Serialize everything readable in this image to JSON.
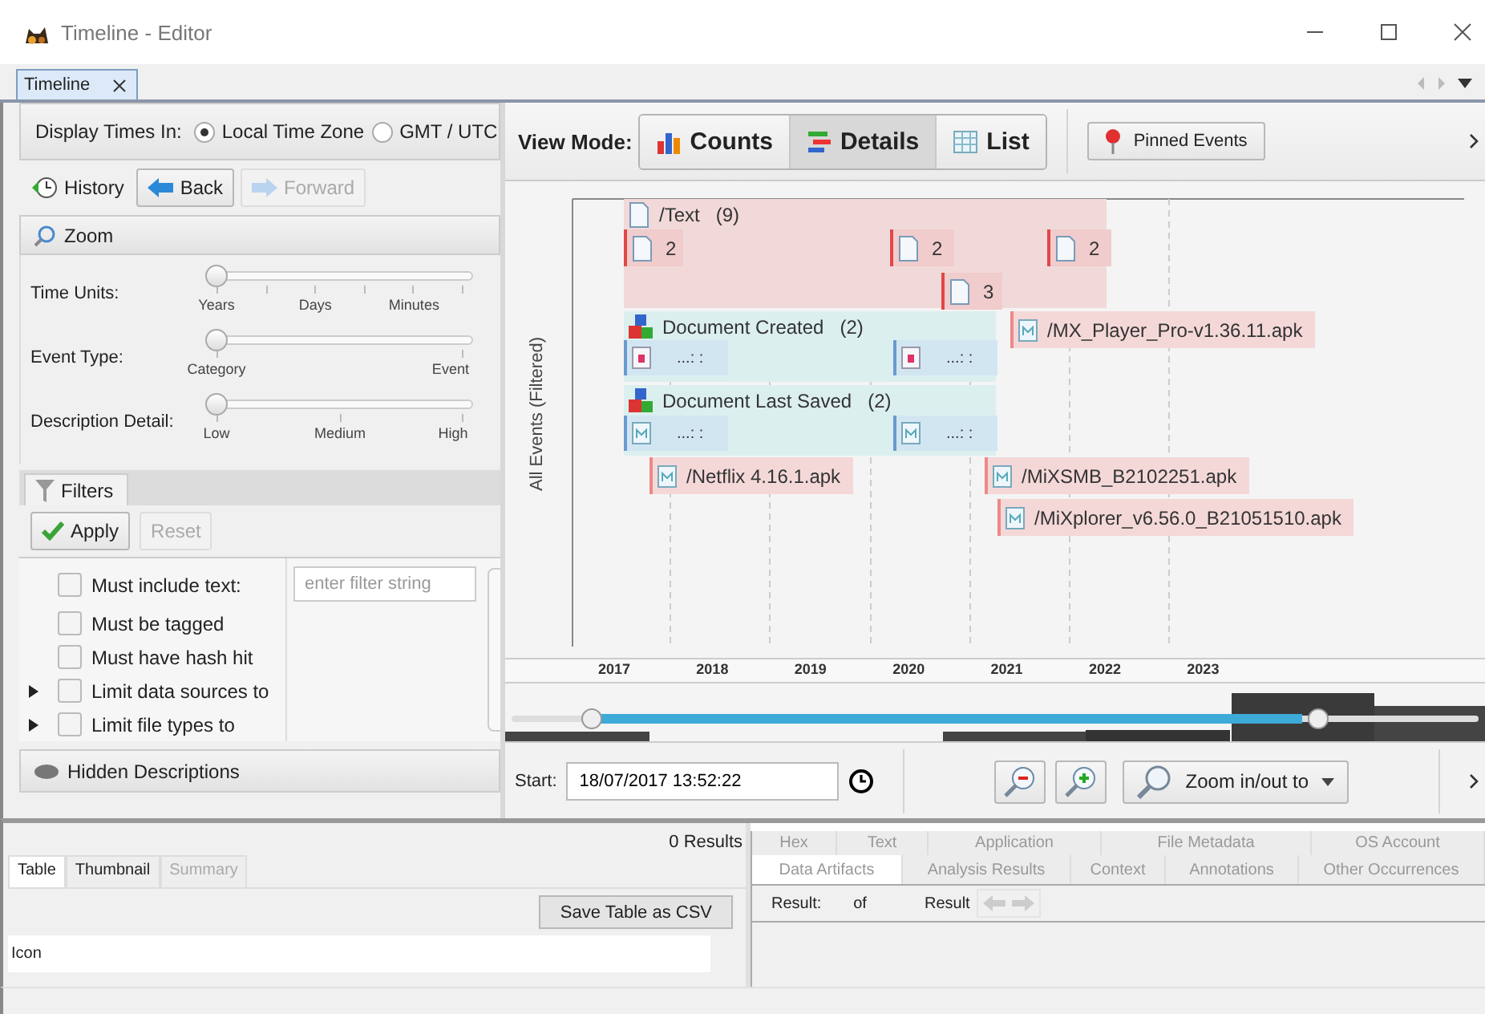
{
  "window": {
    "title": "Timeline - Editor"
  },
  "tabs": [
    {
      "label": "Timeline",
      "selected": true
    }
  ],
  "display_times": {
    "label": "Display Times In:",
    "options": [
      {
        "label": "Local Time Zone",
        "selected": true
      },
      {
        "label": "GMT / UTC",
        "selected": false
      }
    ]
  },
  "history": {
    "label": "History",
    "buttons": [
      {
        "label": "Back",
        "kind": "back",
        "disabled": false
      },
      {
        "label": "Forward",
        "kind": "forward",
        "disabled": true
      }
    ]
  },
  "zoom": {
    "title": "Zoom",
    "sliders": [
      {
        "label": "Time Units:",
        "level": 0,
        "ticks": [
          "Years",
          "Days",
          "Minutes"
        ]
      },
      {
        "label": "Event Type:",
        "level": 0,
        "ticks": [
          "Category",
          "Event"
        ]
      },
      {
        "label": "Description Detail:",
        "level": 0,
        "ticks": [
          "Low",
          "Medium",
          "High"
        ]
      }
    ]
  },
  "filters": {
    "tab": "Filters",
    "buttons": [
      {
        "label": "Apply",
        "kind": "apply",
        "disabled": false
      },
      {
        "label": "Reset",
        "kind": "reset",
        "disabled": true
      }
    ],
    "items": [
      {
        "label": "Must include text:",
        "checked": false,
        "expandable": false
      },
      {
        "label": "Must be tagged",
        "checked": false,
        "expandable": false
      },
      {
        "label": "Must have hash hit",
        "checked": false,
        "expandable": false
      },
      {
        "label": "Limit data sources to",
        "checked": false,
        "expandable": true
      },
      {
        "label": "Limit file types to",
        "checked": false,
        "expandable": true
      }
    ],
    "text_filter": {
      "placeholder": "enter filter string"
    }
  },
  "hidden_descriptions": {
    "title": "Hidden Descriptions"
  },
  "view_mode": {
    "label": "View Mode:",
    "modes": [
      {
        "label": "Counts",
        "kind": "counts",
        "selected": false
      },
      {
        "label": "Details",
        "kind": "details",
        "selected": true
      },
      {
        "label": "List",
        "kind": "list",
        "selected": false
      }
    ],
    "pinned_button": "Pinned Events"
  },
  "timeline": {
    "axis_label": "All Events (Filtered)",
    "events": [
      {
        "kind": "text_cluster",
        "title": "/Text",
        "count": "(9)",
        "color": "#f2d9d9",
        "items": [
          {
            "label": "2"
          },
          {
            "label": "2"
          },
          {
            "label": "2"
          },
          {
            "label": "3"
          }
        ]
      },
      {
        "kind": "type_cluster",
        "title": "Document Created",
        "count": "(2)",
        "color": "#dcefef",
        "items": [
          {
            "label": "...: :"
          },
          {
            "label": "...: :"
          }
        ]
      },
      {
        "kind": "type_cluster",
        "title": "Document Last Saved",
        "count": "(2)",
        "color": "#dcefef",
        "items": [
          {
            "label": "...: :"
          },
          {
            "label": "...: :"
          }
        ]
      },
      {
        "kind": "file_event",
        "title": "/MX_Player_Pro-v1.36.11.apk"
      },
      {
        "kind": "file_event",
        "title": "/Netflix 4.16.1.apk"
      },
      {
        "kind": "file_event",
        "title": "/MiXSMB_B2102251.apk"
      },
      {
        "kind": "file_event",
        "title": "/MiXplorer_v6.56.0_B21051510.apk"
      }
    ],
    "years": [
      "2017",
      "2018",
      "2019",
      "2020",
      "2021",
      "2022",
      "2023"
    ]
  },
  "range": {
    "start_label": "Start:",
    "start_value": "18/07/2017 13:52:22",
    "zoom_menu": "Zoom in/out to"
  },
  "results": {
    "count": "0 Results",
    "tabs": [
      {
        "label": "Table",
        "selected": true,
        "disabled": false
      },
      {
        "label": "Thumbnail",
        "selected": false,
        "disabled": false
      },
      {
        "label": "Summary",
        "selected": false,
        "disabled": true
      }
    ],
    "save_button": "Save Table as CSV",
    "columns": [
      "Icon"
    ]
  },
  "viewer": {
    "tab_rows": [
      [
        {
          "label": "Hex",
          "selected": false
        },
        {
          "label": "Text",
          "selected": false
        },
        {
          "label": "Application",
          "selected": false
        },
        {
          "label": "File Metadata",
          "selected": false
        },
        {
          "label": "OS Account",
          "selected": false
        }
      ],
      [
        {
          "label": "Data Artifacts",
          "selected": true
        },
        {
          "label": "Analysis Results",
          "selected": false
        },
        {
          "label": "Context",
          "selected": false
        },
        {
          "label": "Annotations",
          "selected": false
        },
        {
          "label": "Other Occurrences",
          "selected": false
        }
      ]
    ],
    "result_label": "Result:",
    "of_label": "of",
    "result_text": "Result"
  }
}
